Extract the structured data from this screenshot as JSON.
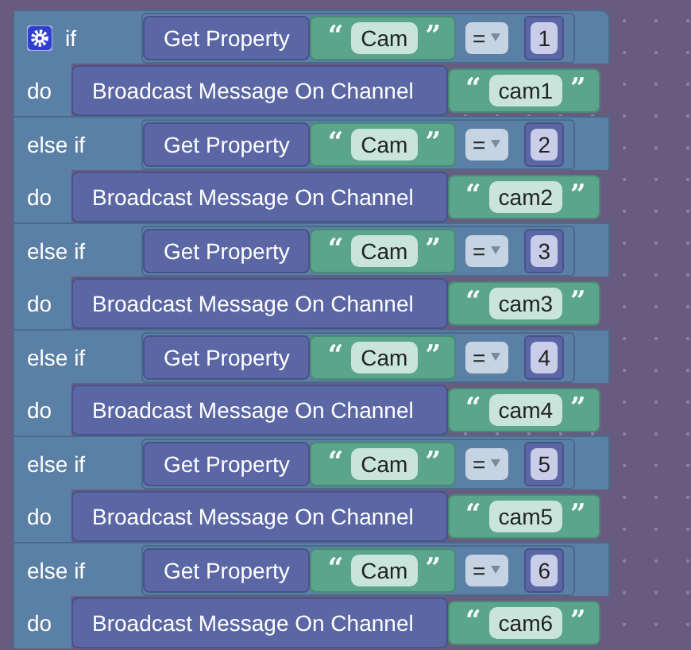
{
  "blocks": [
    {
      "kind": "if",
      "label": "if",
      "property": "Get Property",
      "text": {
        "open": "“",
        "value": "Cam",
        "close": "”"
      },
      "operator": "=",
      "number": "1"
    },
    {
      "kind": "do",
      "label": "do",
      "action": "Broadcast Message On Channel",
      "text": {
        "open": "“",
        "value": "cam1",
        "close": "”"
      }
    },
    {
      "kind": "if",
      "label": "else if",
      "property": "Get Property",
      "text": {
        "open": "“",
        "value": "Cam",
        "close": "”"
      },
      "operator": "=",
      "number": "2"
    },
    {
      "kind": "do",
      "label": "do",
      "action": "Broadcast Message On Channel",
      "text": {
        "open": "“",
        "value": "cam2",
        "close": "”"
      }
    },
    {
      "kind": "if",
      "label": "else if",
      "property": "Get Property",
      "text": {
        "open": "“",
        "value": "Cam",
        "close": "”"
      },
      "operator": "=",
      "number": "3"
    },
    {
      "kind": "do",
      "label": "do",
      "action": "Broadcast Message On Channel",
      "text": {
        "open": "“",
        "value": "cam3",
        "close": "”"
      }
    },
    {
      "kind": "if",
      "label": "else if",
      "property": "Get Property",
      "text": {
        "open": "“",
        "value": "Cam",
        "close": "”"
      },
      "operator": "=",
      "number": "4"
    },
    {
      "kind": "do",
      "label": "do",
      "action": "Broadcast Message On Channel",
      "text": {
        "open": "“",
        "value": "cam4",
        "close": "”"
      }
    },
    {
      "kind": "if",
      "label": "else if",
      "property": "Get Property",
      "text": {
        "open": "“",
        "value": "Cam",
        "close": "”"
      },
      "operator": "=",
      "number": "5"
    },
    {
      "kind": "do",
      "label": "do",
      "action": "Broadcast Message On Channel",
      "text": {
        "open": "“",
        "value": "cam5",
        "close": "”"
      }
    },
    {
      "kind": "if",
      "label": "else if",
      "property": "Get Property",
      "text": {
        "open": "“",
        "value": "Cam",
        "close": "”"
      },
      "operator": "=",
      "number": "6"
    },
    {
      "kind": "do",
      "label": "do",
      "action": "Broadcast Message On Channel",
      "text": {
        "open": "“",
        "value": "cam6",
        "close": "”"
      }
    }
  ]
}
